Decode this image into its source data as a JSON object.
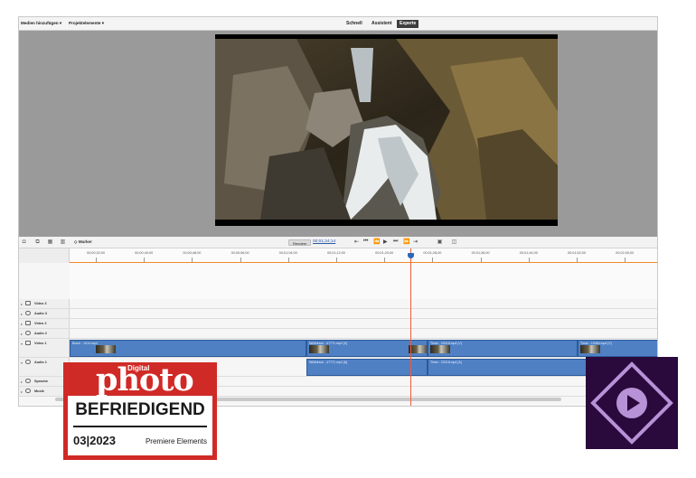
{
  "menu": {
    "add_media": "Medien hinzufügen ▾",
    "project_assets": "Projektelemente ▾"
  },
  "modes": [
    {
      "label": "Schnell",
      "active": false
    },
    {
      "label": "Assistent",
      "active": false
    },
    {
      "label": "Experte",
      "active": true
    }
  ],
  "controls": {
    "marker_label": "Marker",
    "render_label": "Rendern",
    "timecode": "00;01;24;14",
    "playback_icons": [
      "step-back-icon",
      "prev-frame-icon",
      "rewind-icon",
      "play-icon",
      "next-frame-icon",
      "forward-icon",
      "step-forward-icon"
    ]
  },
  "ruler": {
    "ticks": [
      "00;00;32;00",
      "00;00;40;00",
      "00;00;48;00",
      "00;00;56;00",
      "00;01;04;00",
      "00;01;12;00",
      "00;01;20;00",
      "00;01;28;00",
      "00;01;36;00",
      "00;01;44;00",
      "00;01;52;00",
      "00;02;00;00"
    ]
  },
  "tracks": {
    "video3": "Video 3",
    "audio3": "Audio 3",
    "video2": "Video 2",
    "audio2": "Audio 2",
    "video1": "Video 1",
    "audio1": "Audio 1",
    "voice": "Sprache",
    "music": "Musik",
    "clips": {
      "v1_a": "Boom - 1014.mp4",
      "v1_b": "Wildhirsch - 47771.mp4 [V]",
      "v1_c": "Timer - 20218.mp4 [V]",
      "v1_d": "Timer - 10484.mp4 [V]",
      "a1_b": "Wildhirsch - 47771.mp4 [A]",
      "a1_c": "Timer - 20218.mp4 [A]"
    }
  },
  "badge": {
    "digital": "Digital",
    "brand": "photo",
    "rating": "BEFRIEDIGEND",
    "issue": "03|2023",
    "product": "Premiere Elements"
  },
  "colors": {
    "accent_orange": "#ef8a2a",
    "playhead": "#ef5a3c",
    "clip_blue": "#4f80c3",
    "badge_red": "#d02a26",
    "logo_purple": "#2a0a3c"
  }
}
